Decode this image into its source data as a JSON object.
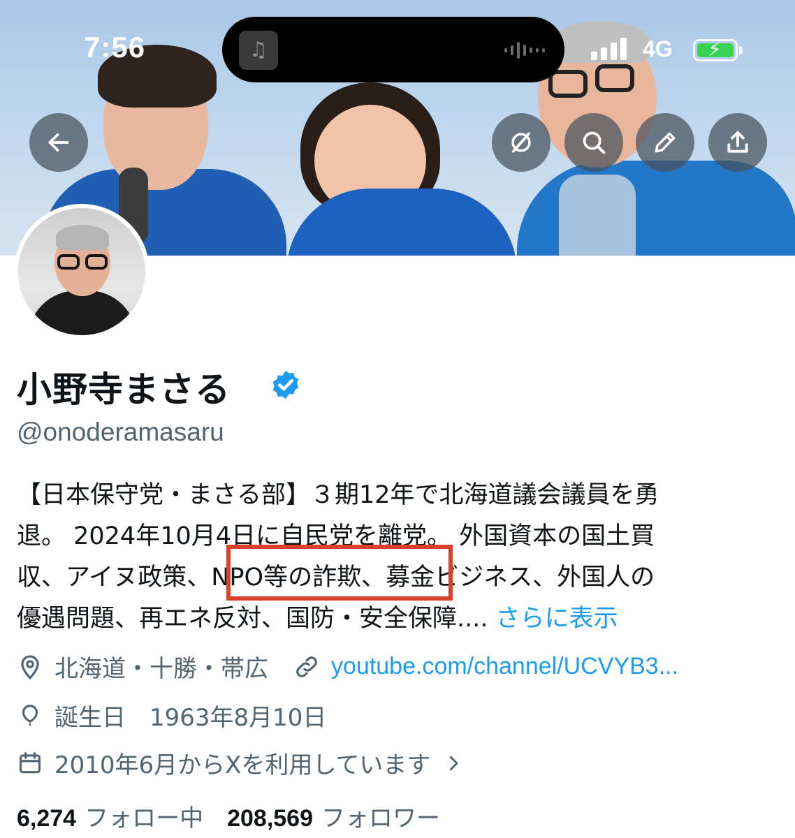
{
  "status_bar": {
    "time": "7:56",
    "network": "4G",
    "island_icon": "music-note-icon",
    "battery_color": "#39d353"
  },
  "header_buttons": {
    "back": "arrow-left-icon",
    "grok": "slash-circle-icon",
    "search": "search-icon",
    "edit": "pencil-icon",
    "share": "share-icon"
  },
  "profile": {
    "display_name": "小野寺まさる",
    "verified_badge_color": "#1d9bf0",
    "handle": "@onoderamasaru",
    "bio_lines": [
      "【日本保守党・まさる部】３期12年で北海道議会議員を勇",
      "退。 2024年10月4日に自民党を離党。 外国資本の国土買",
      "収、アイヌ政策、NPO等の詐欺、募金ビジネス、外国人の",
      "優遇問題、再エネ反対、国防・安全保障...."
    ],
    "bio_more": "さらに表示",
    "highlight_color": "#d9412c",
    "location": "北海道・十勝・帯広",
    "website": "youtube.com/channel/UCVYB3...",
    "birthday": "誕生日　1963年8月10日",
    "joined": "2010年6月からXを利用しています"
  },
  "stats": {
    "following_count": "6,274",
    "following_label": "フォロー中",
    "followers_count": "208,569",
    "followers_label": "フォロワー"
  },
  "colors": {
    "accent": "#1d9bf0",
    "muted_text": "#536471",
    "primary_text": "#0f1419"
  }
}
